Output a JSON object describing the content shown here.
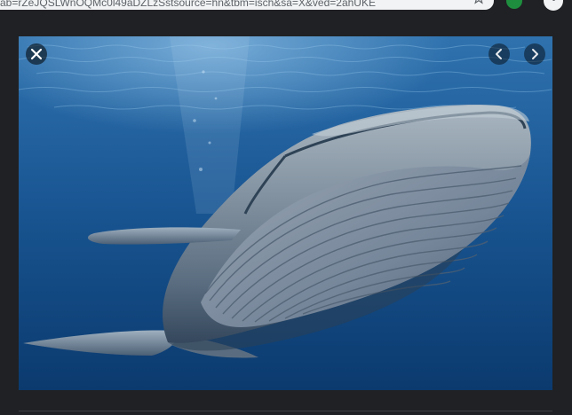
{
  "browser": {
    "url_text": "ab=rZeJQSLWnOQMc0l49aDZLzSstsource=hn&tbm=isch&sa=X&ved=2ahUKE",
    "icons": {
      "bookmark": "star-icon",
      "extension": "extension-icon",
      "menu": "kebab-menu-icon"
    }
  },
  "viewer": {
    "image": {
      "subject": "blue whale underwater",
      "icon": "whale-image"
    },
    "controls": {
      "close_icon": "close-icon",
      "prev_icon": "chevron-left-icon",
      "next_icon": "chevron-right-icon"
    }
  },
  "colors": {
    "page_background": "#202124",
    "ocean_top": "#2a6aa6",
    "ocean_bottom": "#0c3d73",
    "whale_body": "#8b9aa8",
    "whale_shadow": "#3e5266",
    "omnibox": "#f1f3f4",
    "extension_badge": "#1e8e3e"
  }
}
